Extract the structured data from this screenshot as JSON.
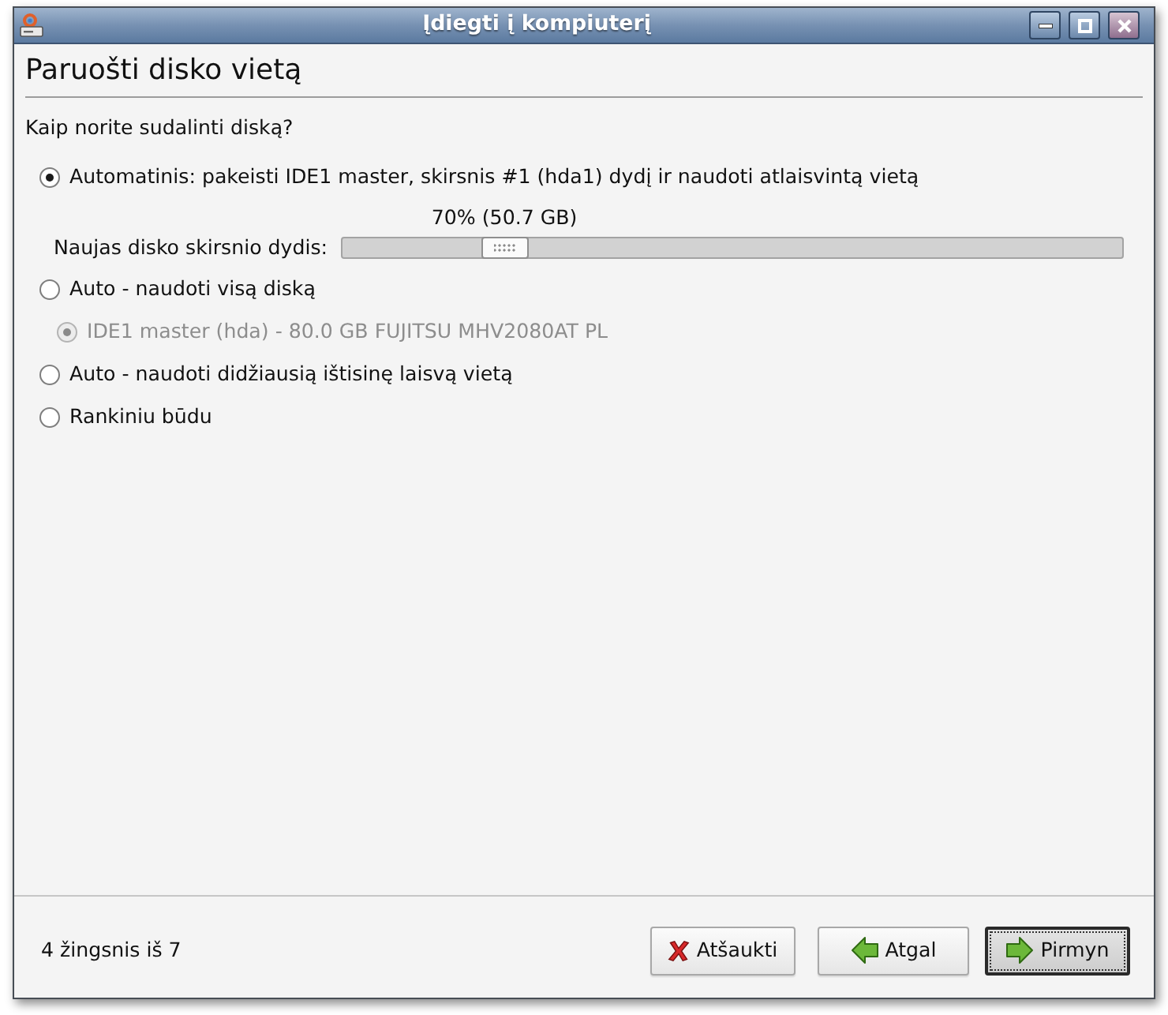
{
  "window": {
    "title": "Įdiegti į kompiuterį"
  },
  "page": {
    "title": "Paruošti disko vietą",
    "question": "Kaip norite sudalinti diską?"
  },
  "options": [
    {
      "label": "Automatinis: pakeisti IDE1 master, skirsnis #1 (hda1) dydį ir naudoti atlaisvintą vietą",
      "selected": true,
      "disabled": false,
      "resize": {
        "label": "Naujas disko skirsnio dydis:",
        "reading": "70% (50.7 GB)",
        "level": 0.19
      }
    },
    {
      "label": "Auto - naudoti visą diską",
      "selected": false,
      "disabled": false,
      "children": [
        {
          "label": "IDE1 master (hda) - 80.0 GB FUJITSU MHV2080AT PL",
          "selected": true,
          "disabled": true
        }
      ]
    },
    {
      "label": "Auto - naudoti didžiausią ištisinę laisvą vietą",
      "selected": false,
      "disabled": false
    },
    {
      "label": "Rankiniu būdu",
      "selected": false,
      "disabled": false
    }
  ],
  "footer": {
    "step": "4 žingsnis iš 7",
    "buttons": [
      {
        "label": "Atšaukti",
        "kind": "cancel",
        "default": false
      },
      {
        "label": "Atgal",
        "kind": "back",
        "default": false
      },
      {
        "label": "Pirmyn",
        "kind": "forward",
        "default": true
      }
    ]
  }
}
